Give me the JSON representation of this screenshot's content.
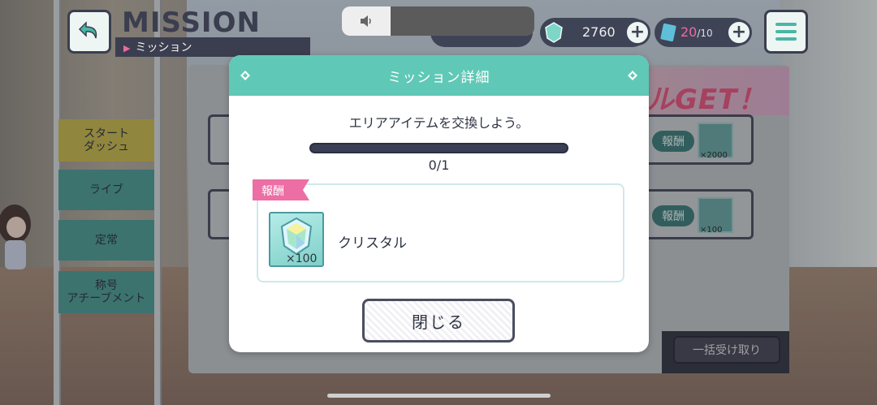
{
  "header": {
    "title": "MISSION",
    "subtitle": "ミッション"
  },
  "currency": {
    "gem_value": "2760",
    "ticket_value": "20",
    "ticket_max": "/10"
  },
  "side_tabs": [
    {
      "label": "スタート\nダッシュ"
    },
    {
      "label": "ライブ"
    },
    {
      "label": "定常"
    },
    {
      "label": "称号\nアチーブメント"
    }
  ],
  "background_panel": {
    "banner": "ルGET！",
    "rows": [
      {
        "badge": "報酬",
        "qty": "×2000"
      },
      {
        "badge": "報酬",
        "qty": "×100"
      }
    ],
    "bulk_receive_label": "一括受け取り"
  },
  "modal": {
    "title": "ミッション詳細",
    "mission_text": "エリアアイテムを交換しよう。",
    "progress_current": 0,
    "progress_total": 1,
    "progress_text": "0/1",
    "reward_tag": "報酬",
    "reward_item_name": "クリスタル",
    "reward_item_qty": "×100",
    "close_label": "閉じる"
  },
  "colors": {
    "modal_header": "#60c8b6",
    "reward_tag": "#ec6ea4",
    "dark_navy": "#3b3e4f"
  },
  "icons": [
    "back-arrow-icon",
    "volume-icon",
    "crystal-icon",
    "ticket-icon",
    "plus-icon",
    "menu-icon",
    "diamond-icon"
  ]
}
